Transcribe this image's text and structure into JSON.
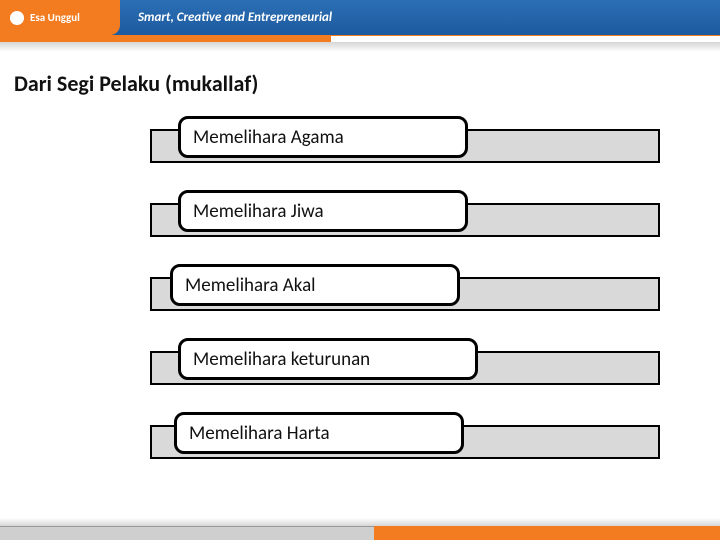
{
  "header": {
    "brand": "Esa Unggul",
    "tagline": "Smart, Creative and Entrepreneurial"
  },
  "title": "Dari Segi Pelaku (mukallaf)",
  "items": [
    {
      "label": "Memelihara Agama"
    },
    {
      "label": "Memelihara Jiwa"
    },
    {
      "label": "Memelihara Akal"
    },
    {
      "label": "Memelihara keturunan"
    },
    {
      "label": "Memelihara Harta"
    }
  ]
}
